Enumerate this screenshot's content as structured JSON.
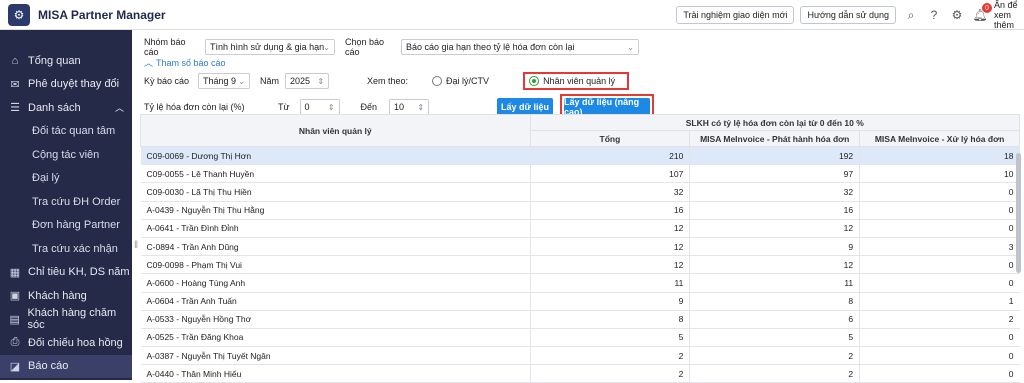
{
  "app": {
    "title": "MISA Partner Manager"
  },
  "topbar": {
    "btn_new_ui": "Trải nghiệm giao diện mới",
    "btn_guide": "Hướng dẫn sử dụng",
    "notif_count": "0",
    "hide_label": "Ẩn để xem thêm"
  },
  "sidebar": {
    "items": [
      {
        "label": "Tổng quan",
        "icon": "home-icon"
      },
      {
        "label": "Phê duyệt thay đổi",
        "icon": "mail-icon"
      },
      {
        "label": "Danh sách",
        "icon": "list-icon"
      },
      {
        "label": "Đối tác quan tâm"
      },
      {
        "label": "Cộng tác viên"
      },
      {
        "label": "Đại lý"
      },
      {
        "label": "Tra cứu ĐH Order"
      },
      {
        "label": "Đơn hàng Partner"
      },
      {
        "label": "Tra cứu xác nhận"
      },
      {
        "label": "Chỉ tiêu KH, DS năm",
        "icon": "target-icon"
      },
      {
        "label": "Khách hàng",
        "icon": "customer-icon"
      },
      {
        "label": "Khách hàng chăm sóc",
        "icon": "care-icon"
      },
      {
        "label": "Đối chiếu hoa hồng",
        "icon": "reconcile-icon"
      },
      {
        "label": "Báo cáo",
        "icon": "report-icon"
      }
    ]
  },
  "filters": {
    "group_label": "Nhóm báo cáo",
    "group_value": "Tình hình sử dụng & gia hạn",
    "report_label": "Chọn báo cáo",
    "report_value": "Báo cáo gia hạn theo tỷ lệ hóa đơn còn lại",
    "params_link": "Tham số báo cáo",
    "period_label": "Kỳ báo cáo",
    "period_value": "Tháng 9",
    "year_label": "Năm",
    "year_value": "2025",
    "view_label": "Xem theo:",
    "opt_agent": "Đại lý/CTV",
    "opt_manager": "Nhân viên quản lý",
    "ratio_label": "Tỷ lệ hóa đơn còn lại (%)",
    "from_label": "Từ",
    "from_value": "0",
    "to_label": "Đến",
    "to_value": "10",
    "btn_get": "Lấy dữ liệu",
    "btn_get_adv": "Lấy dữ liệu (nâng cao)"
  },
  "table": {
    "col_manager": "Nhân viên quản lý",
    "group_header": "SLKH có tỷ lệ hóa đơn còn lại từ 0 đến 10 %",
    "col_total": "Tổng",
    "col_issue": "MISA MeInvoice - Phát hành hóa đơn",
    "col_process": "MISA MeInvoice - Xử lý hóa đơn",
    "rows": [
      {
        "name": "C09-0069 - Dương Thị Hơn",
        "total": "210",
        "issue": "192",
        "process": "18"
      },
      {
        "name": "C09-0055 - Lê Thanh Huyền",
        "total": "107",
        "issue": "97",
        "process": "10"
      },
      {
        "name": "C09-0030 - Lã Thị Thu Hiền",
        "total": "32",
        "issue": "32",
        "process": "0"
      },
      {
        "name": "A-0439 - Nguyễn Thị Thu Hằng",
        "total": "16",
        "issue": "16",
        "process": "0"
      },
      {
        "name": "A-0641 - Trần Đình Đỉnh",
        "total": "12",
        "issue": "12",
        "process": "0"
      },
      {
        "name": "C-0894 - Trần Anh Dũng",
        "total": "12",
        "issue": "9",
        "process": "3"
      },
      {
        "name": "C09-0098 - Phạm Thị Vui",
        "total": "12",
        "issue": "12",
        "process": "0"
      },
      {
        "name": "A-0600 - Hoàng Tùng Anh",
        "total": "11",
        "issue": "11",
        "process": "0"
      },
      {
        "name": "A-0604 - Trần Anh Tuấn",
        "total": "9",
        "issue": "8",
        "process": "1"
      },
      {
        "name": "A-0533 - Nguyễn Hồng Thơ",
        "total": "8",
        "issue": "6",
        "process": "2"
      },
      {
        "name": "A-0525 - Trần Đăng Khoa",
        "total": "5",
        "issue": "5",
        "process": "0"
      },
      {
        "name": "A-0387 - Nguyễn Thị Tuyết Ngân",
        "total": "2",
        "issue": "2",
        "process": "0"
      },
      {
        "name": "A-0440 - Thân Minh Hiếu",
        "total": "2",
        "issue": "2",
        "process": "0"
      }
    ]
  }
}
